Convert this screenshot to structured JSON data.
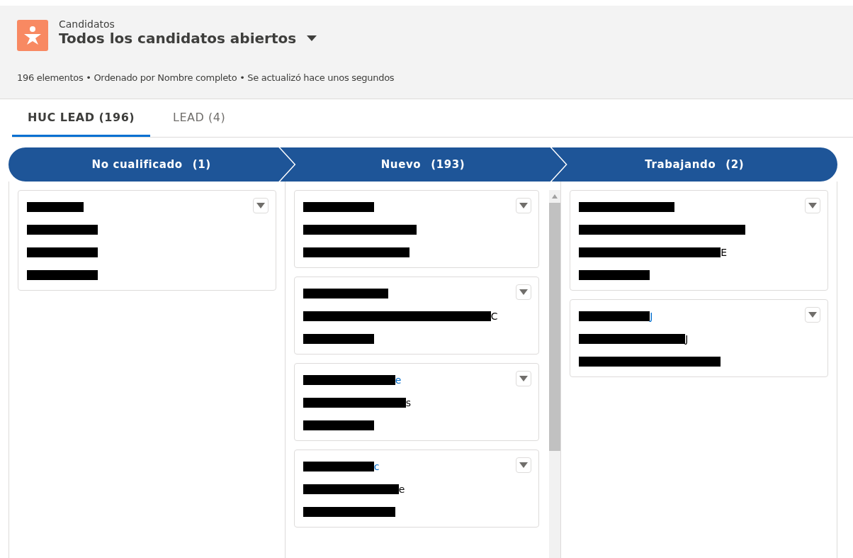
{
  "header": {
    "object": "Candidatos",
    "title": "Todos los candidatos abiertos",
    "summary": "196 elementos • Ordenado por Nombre completo • Se actualizó hace unos segundos"
  },
  "tabs": [
    {
      "label": "HUC LEAD (196)",
      "selected": true
    },
    {
      "label": "LEAD (4)",
      "selected": false
    }
  ],
  "columns": [
    {
      "name": "No cualificado",
      "count": "(1)",
      "scrollbar": false,
      "cards": [
        {
          "lines": [
            {
              "kind": "name",
              "redacted": true
            },
            {
              "kind": "detail",
              "redacted": true
            },
            {
              "kind": "detail",
              "redacted": true
            },
            {
              "kind": "detail",
              "redacted": true
            }
          ]
        }
      ]
    },
    {
      "name": "Nuevo",
      "count": "(193)",
      "scrollbar": true,
      "cards": [
        {
          "lines": [
            {
              "kind": "name",
              "redacted": true
            },
            {
              "kind": "detail",
              "redacted": true
            },
            {
              "kind": "detail",
              "redacted": true
            }
          ]
        },
        {
          "lines": [
            {
              "kind": "name",
              "redacted": true
            },
            {
              "kind": "detail",
              "redacted": true,
              "tail": "C"
            },
            {
              "kind": "detail",
              "redacted": true
            }
          ]
        },
        {
          "lines": [
            {
              "kind": "name",
              "redacted": true,
              "tail": "e"
            },
            {
              "kind": "detail",
              "redacted": true,
              "tail": "s"
            },
            {
              "kind": "detail",
              "redacted": true
            }
          ]
        },
        {
          "lines": [
            {
              "kind": "name",
              "redacted": true,
              "tail": "c"
            },
            {
              "kind": "detail",
              "redacted": true,
              "tail": "e"
            },
            {
              "kind": "detail",
              "redacted": true
            }
          ]
        }
      ]
    },
    {
      "name": "Trabajando",
      "count": "(2)",
      "scrollbar": false,
      "cards": [
        {
          "lines": [
            {
              "kind": "name",
              "redacted": true
            },
            {
              "kind": "detail",
              "redacted": true
            },
            {
              "kind": "detail",
              "redacted": true,
              "tail": "E"
            },
            {
              "kind": "detail",
              "redacted": true
            }
          ]
        },
        {
          "lines": [
            {
              "kind": "name",
              "redacted": true,
              "tail": "J"
            },
            {
              "kind": "detail",
              "redacted": true,
              "tail": "J"
            },
            {
              "kind": "detail",
              "redacted": true
            }
          ]
        }
      ]
    }
  ]
}
